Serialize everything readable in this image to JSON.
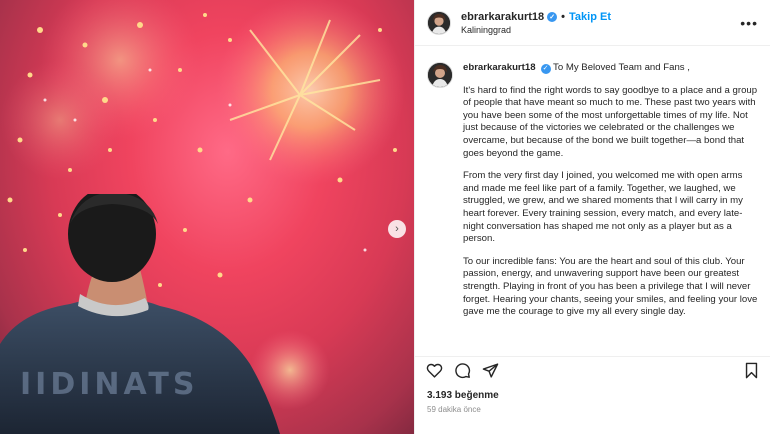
{
  "header": {
    "username": "ebrarkarakurt18",
    "separator": "•",
    "follow_label": "Takip Et",
    "location": "Kalininggrad"
  },
  "caption": {
    "username": "ebrarkarakurt18",
    "first_line": "To My Beloved Team and Fans ,",
    "paragraphs": [
      "It's hard to find the right words to say goodbye to a place and a group of people that have meant so much to me. These past two years with you have been some of the most unforgettable times of my life. Not just because of the victories we celebrated or the challenges we overcame, but because of the bond we built together—a bond that goes beyond the game.",
      "From the very first day I joined, you welcomed me with open arms and made me feel like part of a family. Together, we laughed, we struggled, we grew, and we shared moments that I will carry in my heart forever. Every training session, every match, and every late-night conversation has shaped me not only as a player but as a person.",
      "To our incredible fans: You are the heart and soul of this club. Your passion, energy, and unwavering support have been our greatest strength. Playing in front of you has been a privilege that I will never forget. Hearing your chants, seeing your smiles, and feeling your love gave me the courage to give my all every single day."
    ]
  },
  "stats": {
    "likes": "3.193 beğenme",
    "time": "59 dakika önce"
  },
  "icons": {
    "verified": "verified-badge-icon",
    "more": "more-options-icon",
    "like": "heart-icon",
    "comment": "comment-icon",
    "share": "share-icon",
    "save": "bookmark-icon",
    "next": "chevron-right-icon"
  },
  "colors": {
    "accent": "#0095f6",
    "verified": "#3897f0"
  }
}
